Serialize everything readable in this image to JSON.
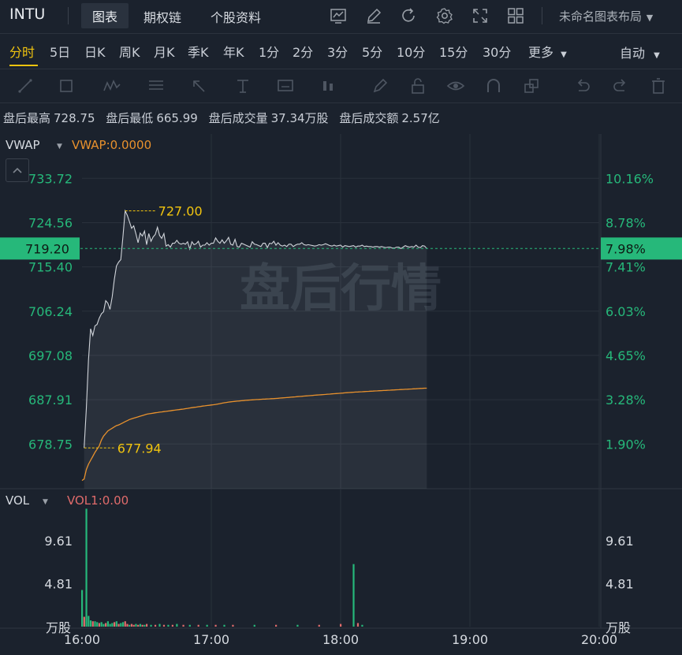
{
  "header": {
    "ticker": "INTU",
    "tabs": [
      {
        "label": "图表",
        "active": true
      },
      {
        "label": "期权链",
        "active": false
      },
      {
        "label": "个股资料",
        "active": false
      }
    ],
    "layout_label": "未命名图表布局",
    "icons": [
      "chart-line-icon",
      "pen-icon",
      "refresh-icon",
      "gear-icon",
      "fullscreen-icon",
      "grid-layout-icon"
    ]
  },
  "periods": {
    "items": [
      "分时",
      "5日",
      "日K",
      "周K",
      "月K",
      "季K",
      "年K",
      "1分",
      "2分",
      "3分",
      "5分",
      "10分",
      "15分",
      "30分",
      "更多"
    ],
    "active": "分时",
    "auto_label": "自动"
  },
  "drawing_tools": [
    "line-tool-icon",
    "rect-tool-icon",
    "wave-tool-icon",
    "fib-tool-icon",
    "arrow-tool-icon",
    "text-tool-icon",
    "note-tool-icon",
    "bar-tool-icon",
    "brush-icon",
    "lock-icon",
    "eye-icon",
    "magnet-icon",
    "layers-icon",
    "undo-icon",
    "redo-icon",
    "trash-icon"
  ],
  "info": {
    "high_label": "盘后最高",
    "high": "728.75",
    "low_label": "盘后最低",
    "low": "665.99",
    "vol_label": "盘后成交量",
    "vol": "37.34万股",
    "amt_label": "盘后成交额",
    "amt": "2.57亿"
  },
  "indicator": {
    "name": "VWAP",
    "value_text": "VWAP:0.0000"
  },
  "vol_indicator": {
    "name": "VOL",
    "value_text": "VOL1:0.00"
  },
  "watermark": "盘后行情",
  "colors": {
    "up": "#26b87a",
    "down": "#e06b6b",
    "accent": "#f1c40f",
    "vwap": "#e8912d",
    "price": "#d0d4da"
  },
  "chart_data": {
    "type": "line",
    "x_ticks": [
      "16:00",
      "17:00",
      "18:00",
      "19:00",
      "20:00"
    ],
    "xlim": [
      0,
      240
    ],
    "y_ticks": [
      678.75,
      687.91,
      697.08,
      706.24,
      715.4,
      724.56,
      733.72
    ],
    "y_ticks_labels": [
      "678.75",
      "687.91",
      "697.08",
      "706.24",
      "715.40",
      "724.56",
      "733.72"
    ],
    "pct_ticks": [
      "1.90%",
      "3.28%",
      "4.65%",
      "6.03%",
      "7.41%",
      "8.78%",
      "10.16%"
    ],
    "ylim": [
      669.5,
      742.9
    ],
    "current_price": "719.20",
    "current_pct": "7.98%",
    "annotations": [
      {
        "label": "727.00",
        "x": 20,
        "y": 727.0
      },
      {
        "label": "677.94",
        "x": 1,
        "y": 677.94
      }
    ],
    "series": [
      {
        "name": "VWAP",
        "x": [
          0,
          1,
          2,
          3,
          4,
          5,
          6,
          7,
          8,
          9,
          10,
          11,
          12,
          13,
          14,
          15,
          16,
          17,
          18,
          19,
          20,
          21,
          22,
          23,
          24,
          25,
          26,
          27,
          28,
          29,
          30,
          31,
          32,
          33,
          34,
          35,
          36,
          37,
          38,
          39,
          40,
          41,
          42,
          43,
          44,
          45,
          46,
          47,
          48,
          49,
          50,
          51,
          52,
          53,
          54,
          55,
          56,
          57,
          58,
          59,
          60,
          61,
          62,
          63,
          64,
          65,
          66,
          67,
          68,
          69,
          70,
          71,
          72,
          73,
          74,
          75,
          76,
          77,
          78,
          79,
          80,
          81,
          82,
          83,
          84,
          85,
          86,
          87,
          88,
          89,
          90,
          91,
          92,
          93,
          94,
          95,
          96,
          97,
          98,
          99,
          100,
          101,
          102,
          103,
          104,
          105,
          106,
          107,
          108,
          109,
          110,
          111,
          112,
          113,
          114,
          115,
          116,
          117,
          118,
          119,
          120,
          121,
          122,
          123,
          124,
          125,
          126,
          127,
          128,
          129,
          130,
          131,
          132,
          133,
          134,
          135,
          136,
          137,
          138,
          139,
          140,
          141,
          142,
          143,
          144,
          145,
          146,
          147,
          148,
          149,
          150,
          151,
          152,
          153,
          154,
          155,
          156,
          157,
          158,
          159,
          160
        ],
        "values": [
          671.2,
          671.5,
          673.46,
          674.55,
          675.37,
          676.18,
          677.0,
          677.67,
          678.36,
          679.56,
          680.38,
          680.92,
          681.46,
          681.74,
          682.01,
          682.28,
          682.55,
          682.69,
          682.91,
          683.14,
          683.38,
          683.58,
          683.8,
          683.95,
          684.1,
          684.23,
          684.36,
          684.5,
          684.64,
          684.77,
          684.91,
          684.99,
          685.06,
          685.13,
          685.2,
          685.26,
          685.34,
          685.39,
          685.45,
          685.5,
          685.57,
          685.62,
          685.69,
          685.74,
          685.81,
          685.86,
          685.93,
          685.98,
          686.05,
          686.12,
          686.2,
          686.26,
          686.33,
          686.39,
          686.47,
          686.52,
          686.59,
          686.64,
          686.71,
          686.76,
          686.82,
          686.87,
          686.93,
          687.01,
          687.1,
          687.19,
          687.28,
          687.35,
          687.42,
          687.48,
          687.53,
          687.58,
          687.62,
          687.66,
          687.7,
          687.74,
          687.78,
          687.81,
          687.85,
          687.88,
          687.91,
          687.94,
          687.97,
          688.0,
          688.03,
          688.05,
          688.08,
          688.1,
          688.13,
          688.15,
          688.18,
          688.21,
          688.25,
          688.29,
          688.33,
          688.36,
          688.39,
          688.43,
          688.47,
          688.51,
          688.55,
          688.58,
          688.62,
          688.66,
          688.7,
          688.73,
          688.77,
          688.8,
          688.84,
          688.87,
          688.91,
          688.94,
          688.98,
          689.01,
          689.05,
          689.08,
          689.12,
          689.15,
          689.19,
          689.22,
          689.26,
          689.29,
          689.33,
          689.36,
          689.4,
          689.43,
          689.47,
          689.49,
          689.52,
          689.54,
          689.57,
          689.59,
          689.62,
          689.64,
          689.67,
          689.69,
          689.72,
          689.74,
          689.77,
          689.79,
          689.82,
          689.84,
          689.87,
          689.89,
          689.92,
          689.94,
          689.97,
          689.99,
          690.02,
          690.04,
          690.07,
          690.09,
          690.12,
          690.14,
          690.17,
          690.19,
          690.22,
          690.24,
          690.27,
          690.29,
          690.3
        ]
      },
      {
        "name": "price",
        "x": [
          1,
          2,
          3,
          4,
          5,
          6,
          7,
          8,
          9,
          10,
          11,
          12,
          13,
          14,
          15,
          16,
          17,
          18,
          19,
          20,
          21,
          22,
          23,
          24,
          25,
          26,
          27,
          28,
          29,
          30,
          31,
          32,
          33,
          34,
          35,
          36,
          37,
          38,
          39,
          40,
          41,
          42,
          43,
          44,
          45,
          46,
          47,
          48,
          49,
          50,
          51,
          52,
          53,
          54,
          55,
          56,
          57,
          58,
          59,
          60,
          61,
          62,
          63,
          64,
          65,
          66,
          67,
          68,
          69,
          70,
          71,
          72,
          73,
          74,
          75,
          76,
          77,
          78,
          79,
          80,
          81,
          82,
          83,
          84,
          85,
          86,
          87,
          88,
          89,
          90,
          91,
          92,
          93,
          94,
          95,
          96,
          97,
          98,
          99,
          100,
          101,
          102,
          103,
          104,
          105,
          106,
          107,
          108,
          109,
          110,
          111,
          112,
          113,
          114,
          115,
          116,
          117,
          118,
          119,
          120,
          121,
          122,
          123,
          124,
          125,
          126,
          127,
          128,
          129,
          130,
          131,
          132,
          133,
          134,
          135,
          136,
          137,
          138,
          139,
          140,
          141,
          142,
          143,
          144,
          145,
          146,
          147,
          148,
          149,
          150,
          151,
          152,
          153,
          154,
          155,
          156,
          157,
          158,
          159,
          160
        ],
        "values": [
          677.94,
          686.1,
          696.1,
          702.6,
          701.2,
          703.2,
          703.5,
          704.8,
          705.7,
          706.1,
          708.4,
          707.9,
          706.6,
          709.2,
          712.8,
          715.6,
          716.4,
          716.9,
          721.6,
          727.0,
          726.1,
          724.8,
          723.4,
          723.9,
          722.3,
          720.4,
          722.4,
          721.8,
          722.8,
          720.0,
          722.3,
          720.7,
          721.6,
          722.1,
          723.6,
          721.9,
          721.3,
          722.3,
          719.7,
          720.0,
          719.5,
          720.3,
          720.3,
          720.9,
          720.3,
          720.1,
          720.3,
          720.1,
          720.6,
          719.1,
          720.6,
          720.0,
          720.2,
          720.7,
          719.5,
          719.9,
          719.9,
          720.4,
          719.9,
          720.3,
          720.3,
          721.4,
          720.7,
          720.3,
          721.0,
          720.3,
          720.8,
          721.5,
          720.1,
          719.9,
          721.1,
          719.6,
          719.5,
          720.3,
          720.1,
          719.9,
          719.7,
          719.5,
          720.6,
          720.1,
          720.0,
          719.8,
          719.6,
          720.3,
          720.3,
          719.4,
          720.3,
          720.2,
          720.7,
          719.9,
          720.4,
          719.9,
          719.7,
          719.9,
          719.6,
          720.1,
          720.1,
          719.6,
          719.9,
          720.1,
          720.1,
          720.4,
          720.0,
          719.9,
          720.0,
          719.9,
          719.8,
          719.7,
          719.8,
          720.0,
          719.9,
          720.0,
          720.2,
          720.0,
          719.8,
          719.7,
          719.9,
          719.7,
          719.8,
          719.9,
          719.5,
          719.8,
          719.7,
          719.6,
          719.7,
          719.8,
          719.5,
          719.7,
          719.7,
          719.9,
          719.6,
          719.7,
          719.6,
          719.6,
          719.5,
          719.6,
          719.6,
          719.5,
          719.6,
          719.5,
          719.4,
          719.5,
          719.5,
          719.3,
          719.3,
          719.5,
          719.5,
          719.2,
          719.5,
          719.8,
          719.6,
          719.5,
          719.6,
          719.5,
          719.9,
          719.5,
          719.4,
          719.8,
          719.7,
          719.2
        ]
      }
    ],
    "volume": {
      "y_ticks": [
        4.81,
        9.61
      ],
      "y_ticks_labels": [
        "4.81",
        "9.61"
      ],
      "unit": "万股",
      "ylim": [
        0,
        13.5
      ],
      "bars": [
        {
          "x": 0,
          "v": 4.1,
          "up": true
        },
        {
          "x": 1,
          "v": 1.1,
          "up": false
        },
        {
          "x": 2,
          "v": 13.2,
          "up": true
        },
        {
          "x": 3,
          "v": 1.2,
          "up": true
        },
        {
          "x": 4,
          "v": 0.7,
          "up": true
        },
        {
          "x": 5,
          "v": 0.6,
          "up": false
        },
        {
          "x": 6,
          "v": 0.6,
          "up": true
        },
        {
          "x": 7,
          "v": 0.5,
          "up": true
        },
        {
          "x": 8,
          "v": 0.4,
          "up": false
        },
        {
          "x": 9,
          "v": 0.5,
          "up": true
        },
        {
          "x": 10,
          "v": 0.3,
          "up": true
        },
        {
          "x": 11,
          "v": 0.4,
          "up": false
        },
        {
          "x": 12,
          "v": 0.6,
          "up": true
        },
        {
          "x": 13,
          "v": 0.3,
          "up": true
        },
        {
          "x": 14,
          "v": 0.4,
          "up": true
        },
        {
          "x": 15,
          "v": 0.5,
          "up": false
        },
        {
          "x": 16,
          "v": 0.6,
          "up": true
        },
        {
          "x": 17,
          "v": 0.3,
          "up": false
        },
        {
          "x": 18,
          "v": 0.4,
          "up": true
        },
        {
          "x": 19,
          "v": 0.5,
          "up": true
        },
        {
          "x": 20,
          "v": 0.6,
          "up": false
        },
        {
          "x": 21,
          "v": 0.3,
          "up": false
        },
        {
          "x": 22,
          "v": 0.2,
          "up": true
        },
        {
          "x": 23,
          "v": 0.3,
          "up": false
        },
        {
          "x": 24,
          "v": 0.2,
          "up": false
        },
        {
          "x": 25,
          "v": 0.3,
          "up": true
        },
        {
          "x": 26,
          "v": 0.2,
          "up": false
        },
        {
          "x": 27,
          "v": 0.3,
          "up": true
        },
        {
          "x": 28,
          "v": 0.2,
          "up": false
        },
        {
          "x": 29,
          "v": 0.2,
          "up": true
        },
        {
          "x": 30,
          "v": 0.3,
          "up": false
        },
        {
          "x": 32,
          "v": 0.2,
          "up": true
        },
        {
          "x": 34,
          "v": 0.2,
          "up": false
        },
        {
          "x": 36,
          "v": 0.3,
          "up": true
        },
        {
          "x": 38,
          "v": 0.2,
          "up": false
        },
        {
          "x": 40,
          "v": 0.2,
          "up": true
        },
        {
          "x": 42,
          "v": 0.2,
          "up": false
        },
        {
          "x": 44,
          "v": 0.3,
          "up": true
        },
        {
          "x": 47,
          "v": 0.2,
          "up": false
        },
        {
          "x": 50,
          "v": 0.2,
          "up": true
        },
        {
          "x": 54,
          "v": 0.2,
          "up": false
        },
        {
          "x": 58,
          "v": 0.2,
          "up": true
        },
        {
          "x": 62,
          "v": 0.2,
          "up": false
        },
        {
          "x": 66,
          "v": 0.2,
          "up": true
        },
        {
          "x": 70,
          "v": 0.2,
          "up": false
        },
        {
          "x": 80,
          "v": 0.2,
          "up": true
        },
        {
          "x": 90,
          "v": 0.2,
          "up": false
        },
        {
          "x": 100,
          "v": 0.2,
          "up": true
        },
        {
          "x": 110,
          "v": 0.2,
          "up": false
        },
        {
          "x": 120,
          "v": 0.3,
          "up": false
        },
        {
          "x": 126,
          "v": 7.0,
          "up": true
        },
        {
          "x": 128,
          "v": 0.4,
          "up": false
        },
        {
          "x": 130,
          "v": 0.2,
          "up": true
        }
      ]
    }
  }
}
